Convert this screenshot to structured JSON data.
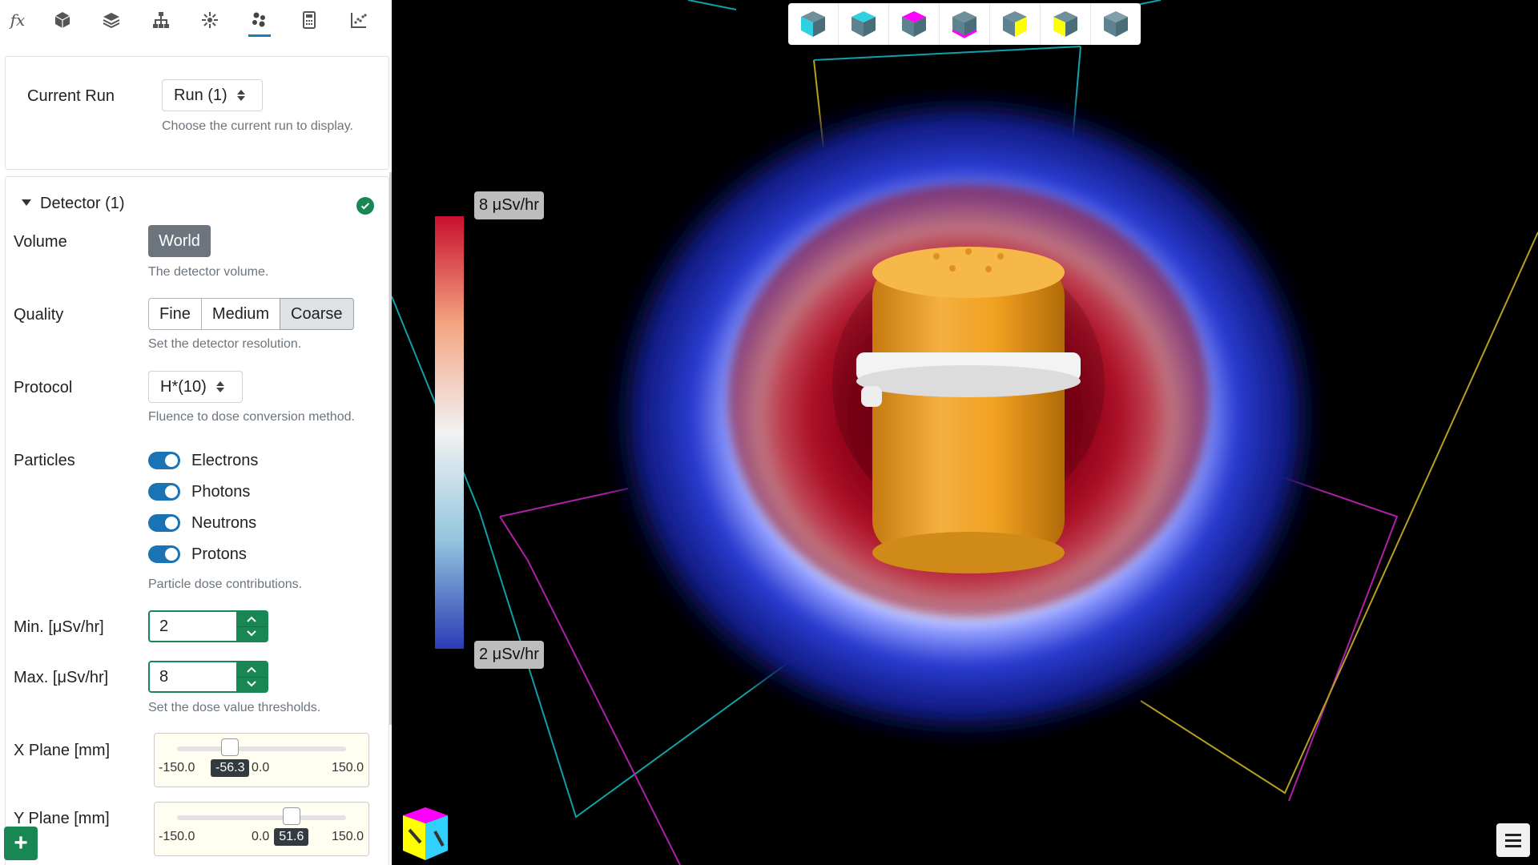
{
  "toolbar": {
    "items": [
      {
        "name": "formula-icon",
        "label": "fx"
      },
      {
        "name": "cube-icon"
      },
      {
        "name": "layers-icon"
      },
      {
        "name": "hierarchy-icon"
      },
      {
        "name": "source-icon"
      },
      {
        "name": "particles-icon",
        "active": true
      },
      {
        "name": "calculator-icon"
      },
      {
        "name": "scatter-plot-icon"
      }
    ]
  },
  "run_card": {
    "label": "Current Run",
    "value": "Run (1)",
    "help": "Choose the current run to display."
  },
  "detector": {
    "title": "Detector (1)",
    "volume_label": "Volume",
    "volume_value": "World",
    "volume_help": "The detector volume.",
    "quality_label": "Quality",
    "quality_options": [
      "Fine",
      "Medium",
      "Coarse"
    ],
    "quality_selected": "Coarse",
    "quality_help": "Set the detector resolution.",
    "protocol_label": "Protocol",
    "protocol_value": "H*(10)",
    "protocol_help": "Fluence to dose conversion method.",
    "particles_label": "Particles",
    "particles": [
      {
        "label": "Electrons",
        "on": true
      },
      {
        "label": "Photons",
        "on": true
      },
      {
        "label": "Neutrons",
        "on": true
      },
      {
        "label": "Protons",
        "on": true
      }
    ],
    "particles_help": "Particle dose contributions.",
    "min_label": "Min. [μSv/hr]",
    "min_value": "2",
    "max_label": "Max. [μSv/hr]",
    "max_value": "8",
    "thresholds_help": "Set the dose value thresholds.",
    "xplane_label": "X Plane [mm]",
    "xplane": {
      "min": "-150.0",
      "mid": "0.0",
      "max": "150.0",
      "value": "-56.3",
      "fraction": 0.31
    },
    "yplane_label": "Y Plane [mm]",
    "yplane": {
      "min": "-150.0",
      "mid": "0.0",
      "max": "150.0",
      "value": "51.6",
      "fraction": 0.67
    }
  },
  "add_button": "+",
  "viewport": {
    "view_buttons": [
      {
        "name": "view-cube-front-icon",
        "accent": "#2fd0e0"
      },
      {
        "name": "view-cube-top-icon",
        "accent": "#2fd0e0"
      },
      {
        "name": "view-cube-magenta-top-icon",
        "accent": "#ff00ff"
      },
      {
        "name": "view-cube-magenta-bottom-icon",
        "accent": "#ff00ff"
      },
      {
        "name": "view-cube-yellow-side-icon",
        "accent": "#ffff00"
      },
      {
        "name": "view-cube-yellow-top-icon",
        "accent": "#ffff00"
      },
      {
        "name": "view-cube-plain-icon",
        "accent": "#6fa3b8"
      }
    ],
    "legend_max": "8 μSv/hr",
    "legend_min": "2 μSv/hr",
    "colors": {
      "high": "#d7263d",
      "mid": "#ffffff",
      "low": "#2a3bd0",
      "object": "#f0a020"
    }
  }
}
